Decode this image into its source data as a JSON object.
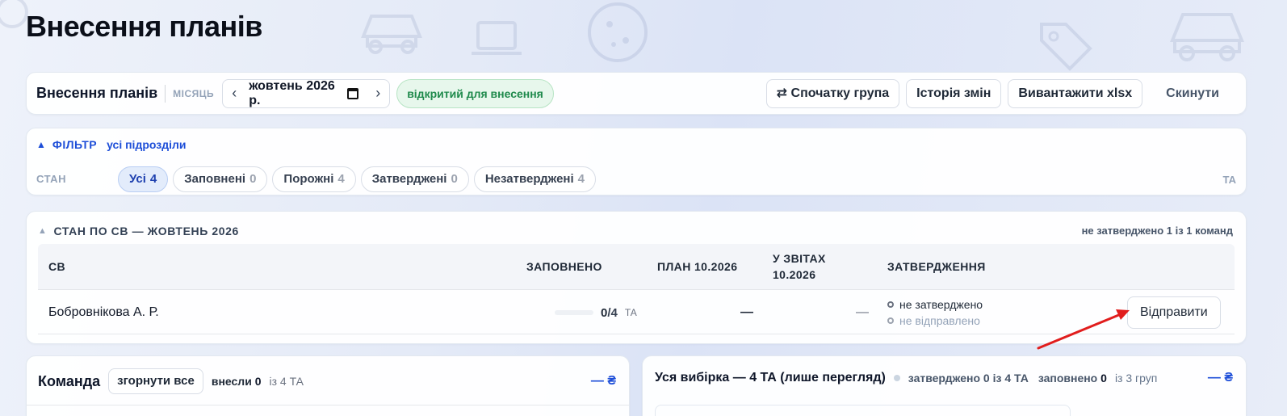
{
  "page": {
    "title": "Внесення планів"
  },
  "toolbar": {
    "title": "Внесення планів",
    "month_label": "МІСЯЦЬ",
    "prev_label": "‹",
    "next_label": "›",
    "month_value": "жовтень 2026 р.",
    "status": "відкритий для внесення",
    "buttons": {
      "group_first": "⇄ Спочатку група",
      "history": "Історія змін",
      "export": "Вивантажити xlsx",
      "reset": "Скинути"
    }
  },
  "filter": {
    "toggle": "▲",
    "label": "ФІЛЬТР",
    "scope": "усі підрозділи",
    "state_label": "СТАН",
    "chips": [
      {
        "label": "Усі",
        "count": "4",
        "active": true
      },
      {
        "label": "Заповнені",
        "count": "0",
        "active": false
      },
      {
        "label": "Порожні",
        "count": "4",
        "active": false
      },
      {
        "label": "Затверджені",
        "count": "0",
        "active": false
      },
      {
        "label": "Незатверджені",
        "count": "4",
        "active": false
      }
    ],
    "ta_label": "ТА"
  },
  "status_table": {
    "toggle": "▲",
    "title": "СТАН ПО СВ — ЖОВТЕНЬ 2026",
    "summary": "не затверджено 1 із 1 команд",
    "columns": {
      "sv": "СВ",
      "filled": "ЗАПОВНЕНО",
      "plan": "ПЛАН 10.2026",
      "reports": "У ЗВІТАХ 10.2026",
      "approval": "ЗАТВЕРДЖЕННЯ"
    },
    "rows": [
      {
        "name": "Бобровнікова А. Р.",
        "filled_done": "0",
        "filled_total": "/4",
        "filled_fraction": 0,
        "unit": "ТА",
        "plan": "—",
        "reports": "—",
        "approval_status": "не затверджено",
        "send_status": "не відправлено",
        "action": "Відправити"
      }
    ]
  },
  "team": {
    "title": "Команда",
    "collapse": "згорнути все",
    "entered_label": "внесли",
    "entered_count": "0",
    "of_label": "із 4 ТА",
    "sum": "— ₴"
  },
  "all_selection": {
    "title": "Уся вибірка — 4 ТА (лише перегляд)",
    "approved": "затверджено 0 із 4 ТА",
    "filled_label": "заповнено",
    "filled_count": "0",
    "groups": "із 3 груп",
    "sum": "— ₴"
  },
  "colors": {
    "accent": "#1d4ed8",
    "status_green": "#1f8a4c",
    "annotation_red": "#e11d1d"
  }
}
